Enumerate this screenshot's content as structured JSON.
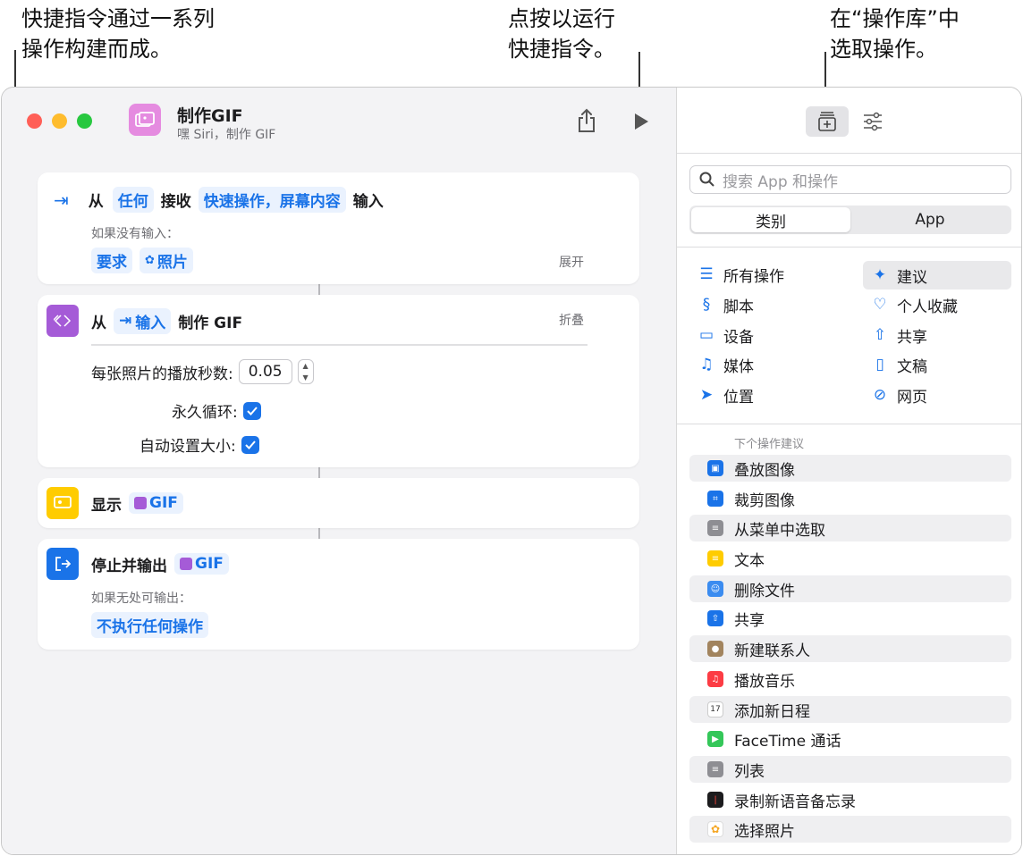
{
  "callouts": {
    "left": [
      "快捷指令通过一系列",
      "操作构建而成。"
    ],
    "middle": [
      "点按以运行",
      "快捷指令。"
    ],
    "right": [
      "在“操作库”中",
      "选取操作。"
    ]
  },
  "header": {
    "title": "制作GIF",
    "subtitle": "嘿 Siri，制作 GIF"
  },
  "actions": {
    "receive": {
      "from": "从",
      "any": "任何",
      "receive": "接收",
      "types": "快速操作，屏幕内容",
      "input": "输入",
      "no_input_label": "如果没有输入：",
      "require": "要求",
      "photos": "照片",
      "expand": "展开"
    },
    "make_gif": {
      "from": "从",
      "input_token": "输入",
      "make": "制作 GIF",
      "collapse": "折叠",
      "seconds_label": "每张照片的播放秒数:",
      "seconds_value": "0.05",
      "loop_label": "永久循环:",
      "autosize_label": "自动设置大小:",
      "loop_checked": true,
      "autosize_checked": true
    },
    "show": {
      "label": "显示",
      "token": "GIF"
    },
    "stop": {
      "label": "停止并输出",
      "token": "GIF",
      "no_output_label": "如果无处可输出：",
      "do_nothing": "不执行任何操作"
    }
  },
  "library": {
    "search_placeholder": "搜索 App 和操作",
    "segments": [
      "类别",
      "App"
    ],
    "categories_left": [
      {
        "label": "所有操作",
        "icon": "list-icon"
      },
      {
        "label": "脚本",
        "icon": "script-icon"
      },
      {
        "label": "设备",
        "icon": "device-icon"
      },
      {
        "label": "媒体",
        "icon": "music-note-icon"
      },
      {
        "label": "位置",
        "icon": "location-icon"
      }
    ],
    "categories_right": [
      {
        "label": "建议",
        "icon": "sparkle-icon"
      },
      {
        "label": "个人收藏",
        "icon": "heart-icon"
      },
      {
        "label": "共享",
        "icon": "share-icon"
      },
      {
        "label": "文稿",
        "icon": "document-icon"
      },
      {
        "label": "网页",
        "icon": "compass-icon"
      }
    ],
    "suggestions_header": "下个操作建议",
    "suggestions": [
      {
        "label": "叠放图像",
        "color": "#1a73e8"
      },
      {
        "label": "裁剪图像",
        "color": "#1a73e8"
      },
      {
        "label": "从菜单中选取",
        "color": "#8e8e93"
      },
      {
        "label": "文本",
        "color": "#ffcc00"
      },
      {
        "label": "删除文件",
        "color": "#3b8cf0"
      },
      {
        "label": "共享",
        "color": "#1a73e8"
      },
      {
        "label": "新建联系人",
        "color": "#a2845e"
      },
      {
        "label": "播放音乐",
        "color": "#fc3c44"
      },
      {
        "label": "添加新日程",
        "color": "#ffffff"
      },
      {
        "label": "FaceTime 通话",
        "color": "#34c759"
      },
      {
        "label": "列表",
        "color": "#8e8e93"
      },
      {
        "label": "录制新语音备忘录",
        "color": "#1c1c1e"
      },
      {
        "label": "选择照片",
        "color": "#ffffff"
      }
    ]
  }
}
